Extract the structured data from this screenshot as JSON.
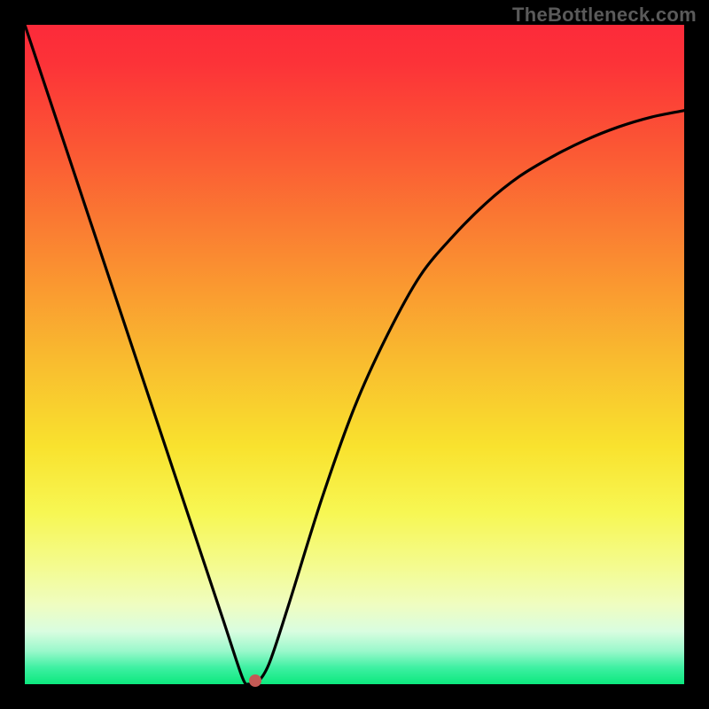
{
  "watermark": "TheBottleneck.com",
  "chart_data": {
    "type": "line",
    "title": "",
    "xlabel": "",
    "ylabel": "",
    "xlim": [
      0,
      100
    ],
    "ylim": [
      0,
      100
    ],
    "grid": false,
    "background_gradient": {
      "top_color": "#fc2a3a",
      "middle_color": "#f9e22e",
      "bottom_color": "#0ce87e"
    },
    "series": [
      {
        "name": "bottleneck-curve",
        "color": "#000000",
        "x": [
          0,
          5,
          10,
          15,
          20,
          25,
          30,
          33,
          34,
          35,
          37,
          40,
          45,
          50,
          55,
          60,
          65,
          70,
          75,
          80,
          85,
          90,
          95,
          100
        ],
        "values": [
          100,
          85,
          70,
          55,
          40,
          25,
          10,
          1,
          0,
          0,
          3,
          12,
          28,
          42,
          53,
          62,
          68,
          73,
          77,
          80,
          82.5,
          84.5,
          86,
          87
        ]
      }
    ],
    "marker": {
      "name": "optimum-point",
      "x": 35,
      "y": 0.5,
      "color": "#c45a55"
    }
  }
}
